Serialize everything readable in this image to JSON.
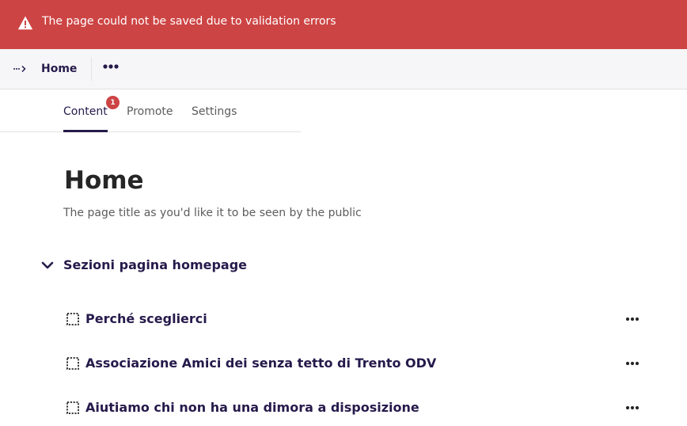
{
  "banner": {
    "message": "The page could not be saved due to validation errors",
    "icon": "warning-icon",
    "color": "#cd4444"
  },
  "header": {
    "breadcrumb_icon": "breadcrumb-expand-icon",
    "breadcrumb_home": "Home",
    "more_icon": "more-actions-icon"
  },
  "tabs": [
    {
      "label": "Content",
      "active": true,
      "error_count": "1"
    },
    {
      "label": "Promote",
      "active": false
    },
    {
      "label": "Settings",
      "active": false
    }
  ],
  "main": {
    "title": "Home",
    "title_help": "The page title as you'd like it to be seen by the public",
    "section": {
      "label": "Sezioni pagina homepage",
      "expanded": true,
      "blocks": [
        {
          "label": "Perché sceglierci"
        },
        {
          "label": "Associazione Amici dei senza tetto di Trento ODV"
        },
        {
          "label": "Aiutiamo chi non ha una dimora a disposizione"
        }
      ]
    }
  },
  "colors": {
    "primary": "#261a4b",
    "error": "#cd4444",
    "text": "#262626",
    "muted": "#5c5c5c"
  }
}
